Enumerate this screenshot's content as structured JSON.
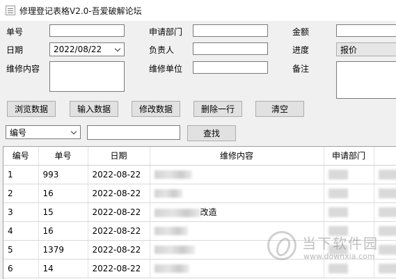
{
  "window": {
    "title": "修理登记表格V2.0-吾爱破解论坛",
    "icon": "form-app-icon"
  },
  "form": {
    "order_no": {
      "label": "单号",
      "value": ""
    },
    "department": {
      "label": "申请部门",
      "value": ""
    },
    "amount": {
      "label": "金额",
      "value": ""
    },
    "date": {
      "label": "日期",
      "value": "2022/08/22"
    },
    "owner": {
      "label": "负责人",
      "value": ""
    },
    "progress": {
      "label": "进度",
      "value": "报价"
    },
    "repair_content": {
      "label": "维修内容",
      "value": ""
    },
    "repair_unit": {
      "label": "维修单位",
      "value": ""
    },
    "remark": {
      "label": "备注",
      "value": ""
    }
  },
  "buttons": {
    "browse": "浏览数据",
    "input": "输入数据",
    "modify": "修改数据",
    "delete_row": "删除一行",
    "clear": "清空",
    "search": "查找"
  },
  "search": {
    "field": "编号",
    "value": ""
  },
  "table": {
    "columns": [
      "编号",
      "单号",
      "日期",
      "维修内容",
      "申请部门"
    ],
    "rows": [
      {
        "id": "1",
        "order": "993",
        "date": "2022-08-22",
        "content": ""
      },
      {
        "id": "2",
        "order": "16",
        "date": "2022-08-22",
        "content": ""
      },
      {
        "id": "3",
        "order": "15",
        "date": "2022-08-22",
        "content": "改造"
      },
      {
        "id": "4",
        "order": "16",
        "date": "2022-08-22",
        "content": ""
      },
      {
        "id": "5",
        "order": "1379",
        "date": "2022-08-22",
        "content": ""
      },
      {
        "id": "6",
        "order": "14",
        "date": "2022-08-22",
        "content": ""
      }
    ]
  },
  "watermark": {
    "text": "当下软件园",
    "url": "www.downxia.com"
  }
}
